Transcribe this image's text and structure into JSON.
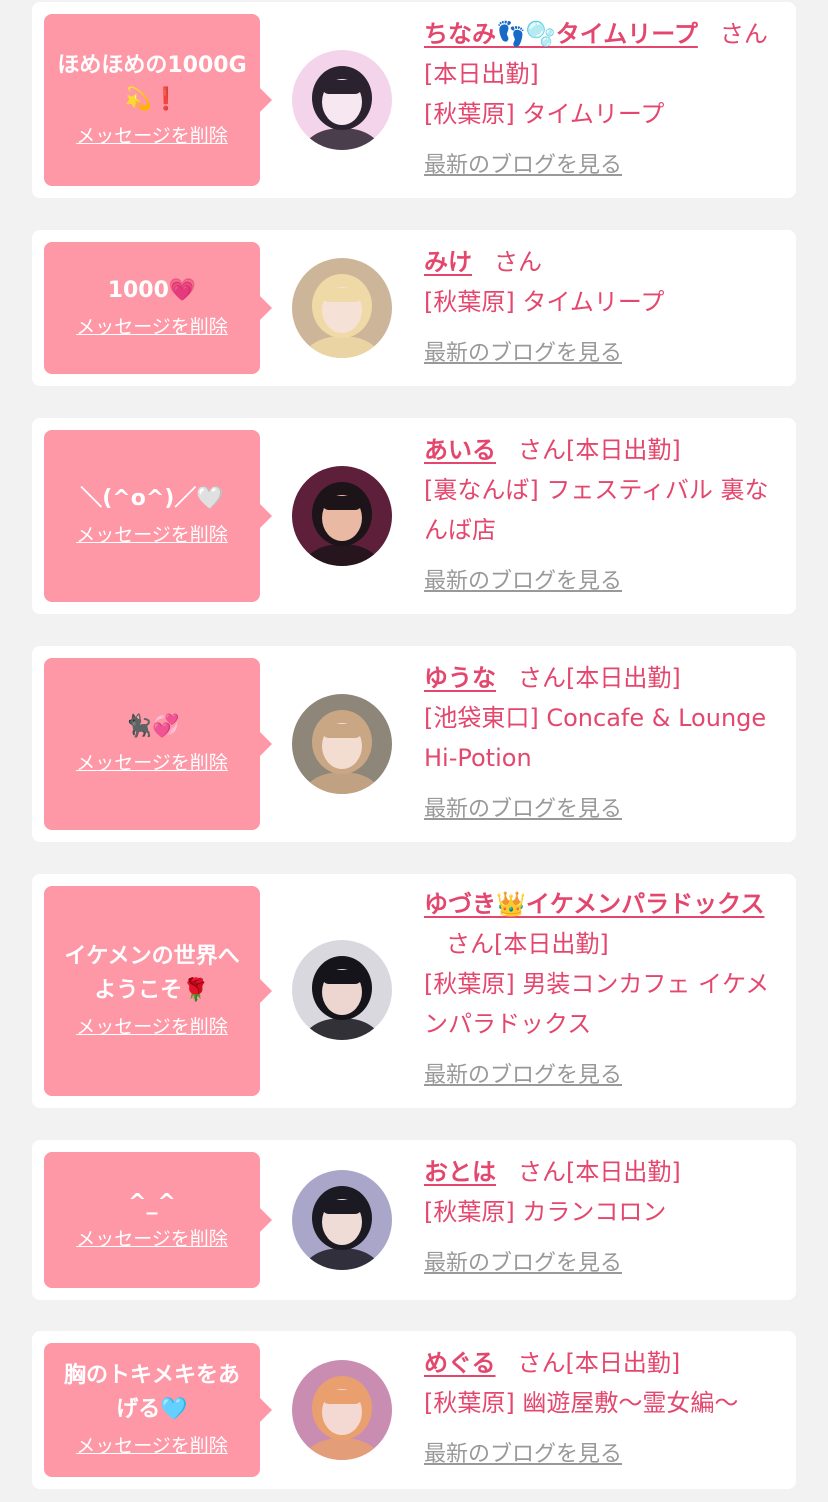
{
  "colors": {
    "page_background": "#f2f2f2",
    "card_background": "#ffffff",
    "bubble_background": "#fe97a6",
    "accent_pink": "#e4476e",
    "link_gray": "#999999"
  },
  "cards": [
    {
      "message": "ほめほめの1000G\n💫❗",
      "delete_label": "メッセージを削除",
      "name": "ちなみ👣🫧タイムリープ",
      "honorific": "さん",
      "badge": "[本日出勤]",
      "shop": "[秋葉原] タイムリープ",
      "blog_label": "最新のブログを見る",
      "avatar_colors": [
        "#f3d4ea",
        "#2b2230",
        "#f7e7f0"
      ]
    },
    {
      "message": "1000💗",
      "delete_label": "メッセージを削除",
      "name": "みけ",
      "honorific": "さん",
      "badge": "",
      "shop": "[秋葉原] タイムリープ",
      "blog_label": "最新のブログを見る",
      "avatar_colors": [
        "#cdb59a",
        "#efd9a6",
        "#f6e1d7"
      ]
    },
    {
      "message": "＼(^o^)／🤍",
      "delete_label": "メッセージを削除",
      "name": "あいる",
      "honorific": "さん",
      "badge": "[本日出勤]",
      "shop": "[裏なんば] フェスティバル 裏なんば店",
      "blog_label": "最新のブログを見る",
      "avatar_colors": [
        "#5e1f3a",
        "#1c1418",
        "#e9b9a4"
      ]
    },
    {
      "message": "🐈‍⬛💞",
      "delete_label": "メッセージを削除",
      "name": "ゆうな",
      "honorific": "さん",
      "badge": "[本日出勤]",
      "shop": "[池袋東口] Concafe & Lounge Hi-Potion",
      "blog_label": "最新のブログを見る",
      "avatar_colors": [
        "#8e8678",
        "#c9a784",
        "#f3ddd1"
      ]
    },
    {
      "message": "イケメンの世界へ\nようこそ🌹",
      "delete_label": "メッセージを削除",
      "name": "ゆづき👑イケメンパラドックス",
      "honorific": "さん",
      "badge": "[本日出勤]",
      "shop": "[秋葉原] 男装コンカフェ イケメンパラドックス",
      "blog_label": "最新のブログを見る",
      "avatar_colors": [
        "#d8d8de",
        "#15141a",
        "#ecd6cf"
      ]
    },
    {
      "message": "^_^",
      "delete_label": "メッセージを削除",
      "name": "おとは",
      "honorific": "さん",
      "badge": "[本日出勤]",
      "shop": "[秋葉原] カランコロン",
      "blog_label": "最新のブログを見る",
      "avatar_colors": [
        "#a9a6c9",
        "#1b1a22",
        "#f0dcd6"
      ]
    },
    {
      "message": "胸のトキメキをあげる🩵",
      "delete_label": "メッセージを削除",
      "name": "めぐる",
      "honorific": "さん",
      "badge": "[本日出勤]",
      "shop": "[秋葉原] 幽遊屋敷〜霊女編〜",
      "blog_label": "最新のブログを見る",
      "avatar_colors": [
        "#c98db2",
        "#e9a06e",
        "#f4d9d2"
      ]
    }
  ]
}
